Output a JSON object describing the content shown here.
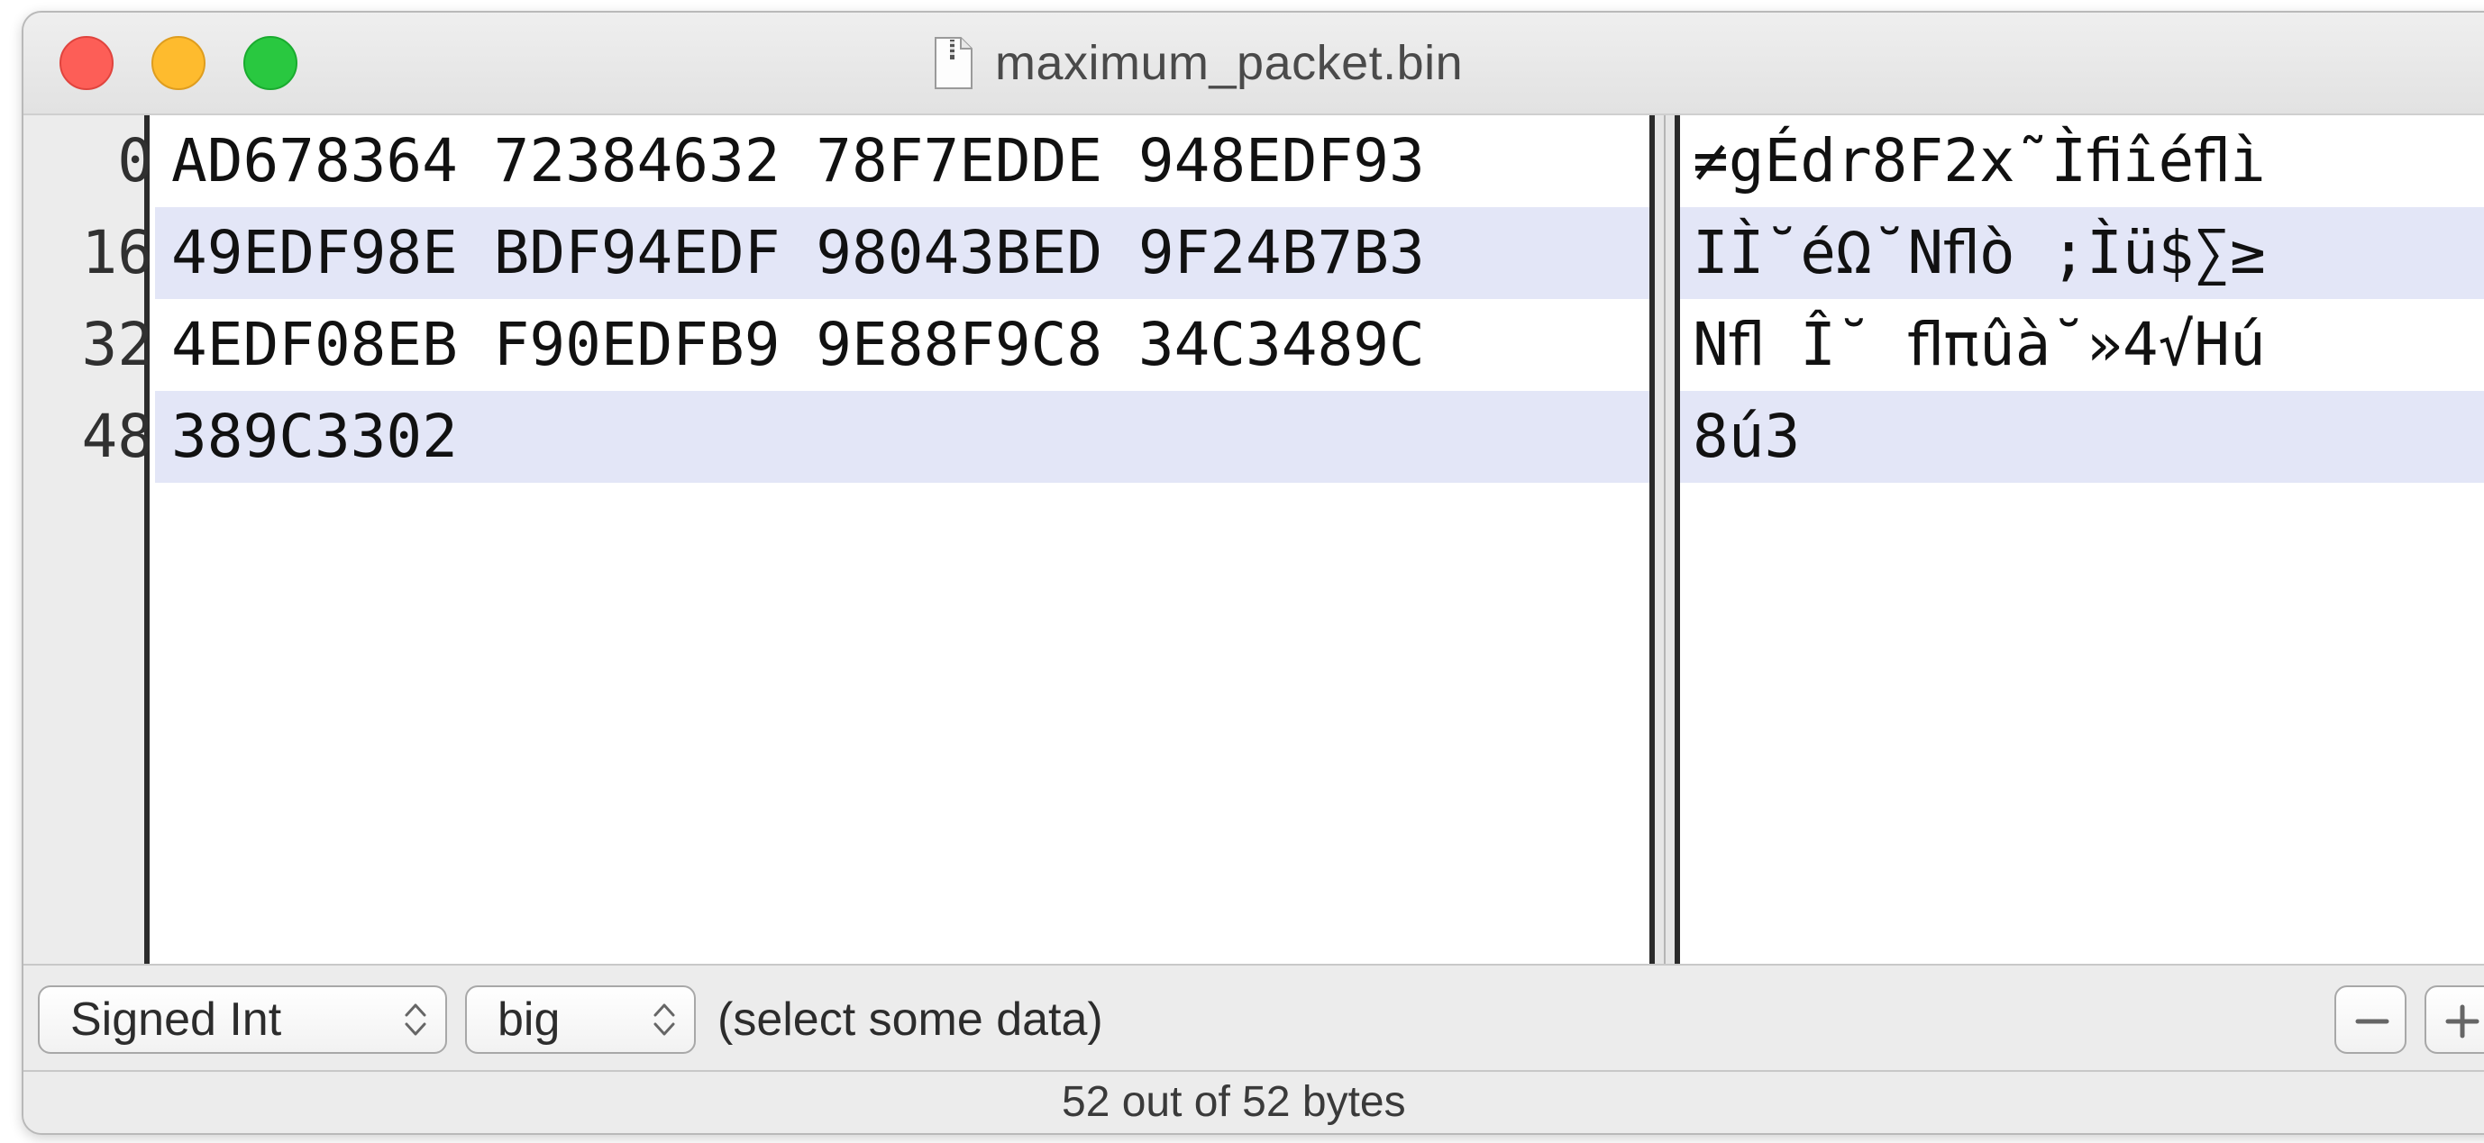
{
  "window": {
    "title": "maximum_packet.bin",
    "file_icon": "document-icon"
  },
  "traffic_lights": {
    "close_color": "#fd5e57",
    "minimize_color": "#febb2e",
    "zoom_color": "#29c840"
  },
  "rows": [
    {
      "offset": "0",
      "hex": "AD678364 72384632 78F7EDDE 948EDF93",
      "ascii": "≠gÉdr8F2x˜Ìﬁîéﬂì"
    },
    {
      "offset": "16",
      "hex": "49EDF98E BDF94EDF 98043BED 9F24B7B3",
      "ascii": "IÌ˘éΩ˘Nﬂò ;Ìü$∑≥"
    },
    {
      "offset": "32",
      "hex": "4EDF08EB F90EDFB9 9E88F9C8 34C3489C",
      "ascii": "Nﬂ Î˘ ﬂπûà˘»4√Hú"
    },
    {
      "offset": "48",
      "hex": "389C3302",
      "ascii": "8ú3"
    }
  ],
  "row_highlight_color": "#e3e6f7",
  "toolbar": {
    "type_select": "Signed Int",
    "endian_select": "big",
    "value_text": "(select some data)",
    "minus_icon": "minus-icon",
    "plus_icon": "plus-icon"
  },
  "status": {
    "text": "52 out of 52 bytes"
  }
}
